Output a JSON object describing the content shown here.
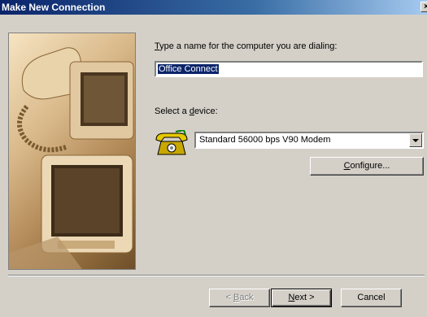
{
  "window": {
    "title": "Make New Connection",
    "close_glyph": "×"
  },
  "form": {
    "name_label_accel": "T",
    "name_label_rest": "ype a name for the computer you are dialing:",
    "name_value": "Office Connect",
    "device_label_pre": "Select a ",
    "device_label_accel": "d",
    "device_label_rest": "evice:",
    "device_value": "Standard 56000 bps V90 Modem",
    "device_icon": "telephone-icon"
  },
  "buttons": {
    "configure_accel": "C",
    "configure_rest": "onfigure...",
    "back_pre": "< ",
    "back_accel": "B",
    "back_rest": "ack",
    "next_accel": "N",
    "next_rest": "ext >",
    "cancel": "Cancel"
  },
  "colors": {
    "titlebar": "#0a246a",
    "face": "#d4d0c8",
    "selection": "#0a246a"
  }
}
